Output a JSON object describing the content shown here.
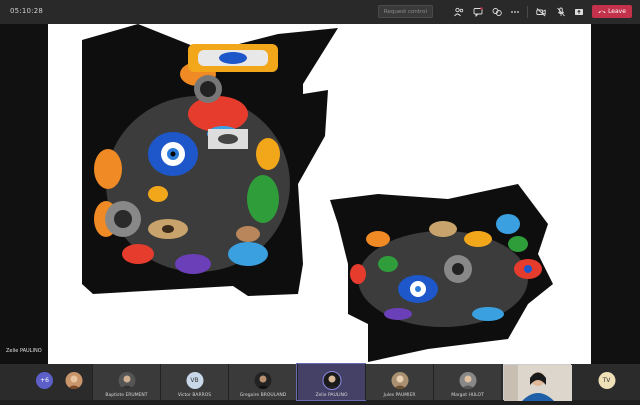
{
  "topbar": {
    "timer": "05:10:28",
    "request_control_label": "Request control",
    "leave_label": "Leave"
  },
  "presenter": {
    "name": "Zelie PAULINO"
  },
  "gallery": {
    "overflow_count": "+6",
    "participants": [
      {
        "name": "",
        "initials": ""
      },
      {
        "name": "Baptiste ERUMENT",
        "initials": ""
      },
      {
        "name": "Victor BARROS",
        "initials": "VB"
      },
      {
        "name": "Gregoire BROULAND",
        "initials": ""
      },
      {
        "name": "Zelie PAULINO",
        "initials": ""
      },
      {
        "name": "Jules PAUMIER",
        "initials": ""
      },
      {
        "name": "Margot HULOT",
        "initials": ""
      },
      {
        "name": "",
        "initials": ""
      },
      {
        "name": "",
        "initials": "TV"
      }
    ]
  },
  "colors": {
    "leave": "#c4314b",
    "accent": "#5b5fc7",
    "topbar": "#292929"
  }
}
